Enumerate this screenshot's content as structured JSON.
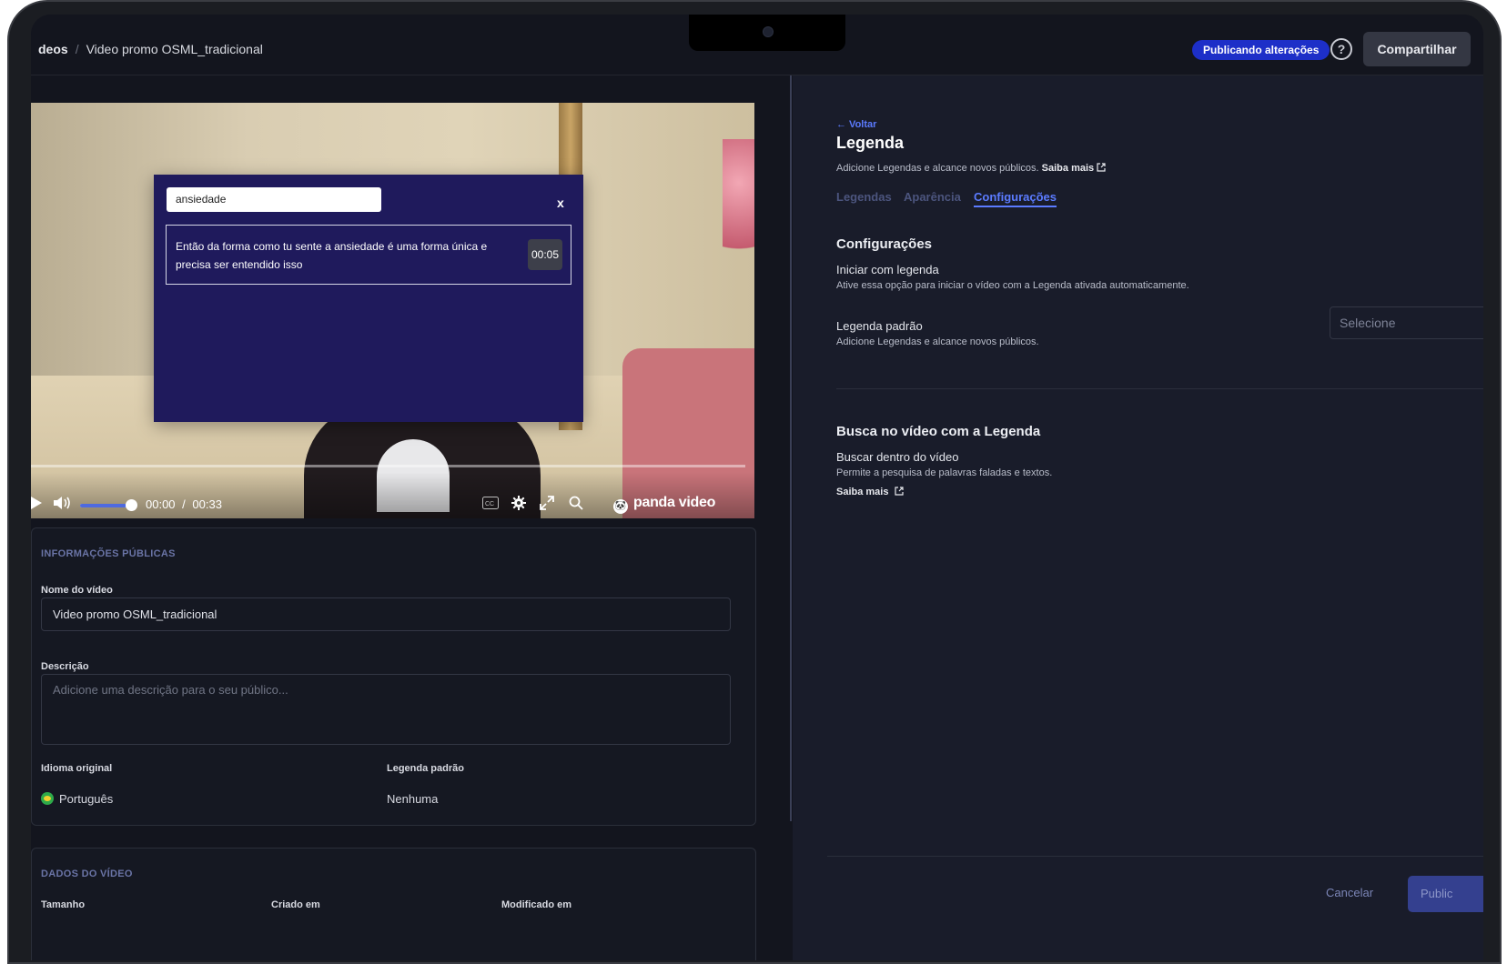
{
  "breadcrumb": {
    "parent": "deos",
    "current": "Video promo OSML_tradicional"
  },
  "header": {
    "status_badge": "Publicando alterações",
    "help_icon": "?",
    "share_label": "Compartilhar"
  },
  "player": {
    "time_current": "00:00",
    "time_separator": "/",
    "time_total": "00:33",
    "volume_level": 0.85,
    "brand": "panda video",
    "search": {
      "query": "ansiedade",
      "close_label": "x",
      "results": [
        {
          "text": "Então da forma como tu sente a ansiedade é uma forma única e precisa ser entendido isso",
          "time": "00:05"
        }
      ]
    }
  },
  "public_info": {
    "section_title": "INFORMAÇÕES PÚBLICAS",
    "name_label": "Nome do vídeo",
    "name_value": "Video promo OSML_tradicional",
    "desc_label": "Descrição",
    "desc_placeholder": "Adicione uma descrição para o seu público...",
    "lang_label": "Idioma original",
    "lang_value": "Português",
    "subtitle_label": "Legenda padrão",
    "subtitle_value": "Nenhuma"
  },
  "video_data": {
    "section_title": "DADOS DO VÍDEO",
    "columns": [
      "Tamanho",
      "Criado em",
      "Modificado em"
    ]
  },
  "subtitle_panel": {
    "back_label": "← Voltar",
    "title": "Legenda",
    "subtitle": "Adicione Legendas e alcance novos públicos.",
    "learn_more": "Saiba mais",
    "tabs": [
      "Legendas",
      "Aparência",
      "Configurações"
    ],
    "active_tab": "Configurações",
    "config_heading": "Configurações",
    "start_title": "Iniciar com legenda",
    "start_desc": "Ative essa opção para iniciar o vídeo com a Legenda ativada automaticamente.",
    "default_title": "Legenda padrão",
    "default_desc": "Adicione Legendas e alcance novos públicos.",
    "select_placeholder": "Selecione",
    "search_heading": "Busca no vídeo com a Legenda",
    "search_title": "Buscar dentro do vídeo",
    "search_desc": "Permite a pesquisa de palavras faladas e textos.",
    "search_more": "Saiba mais",
    "cancel_label": "Cancelar",
    "publish_label": "Public"
  }
}
